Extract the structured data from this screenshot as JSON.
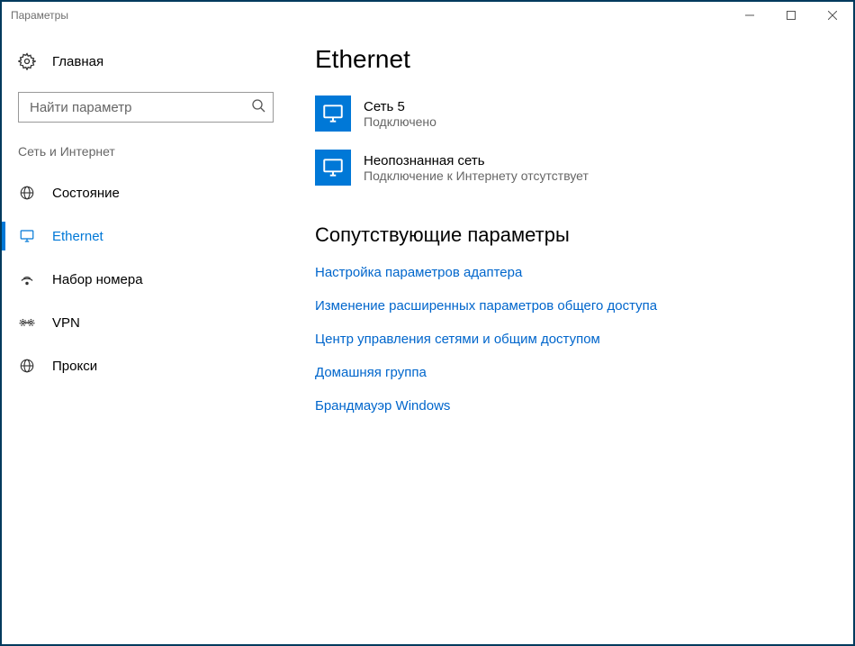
{
  "window": {
    "title": "Параметры"
  },
  "sidebar": {
    "home": "Главная",
    "search_placeholder": "Найти параметр",
    "category": "Сеть и Интернет",
    "items": [
      {
        "label": "Состояние"
      },
      {
        "label": "Ethernet"
      },
      {
        "label": "Набор номера"
      },
      {
        "label": "VPN"
      },
      {
        "label": "Прокси"
      }
    ]
  },
  "main": {
    "title": "Ethernet",
    "networks": [
      {
        "name": "Сеть  5",
        "status": "Подключено"
      },
      {
        "name": "Неопознанная сеть",
        "status": "Подключение к Интернету отсутствует"
      }
    ],
    "related_title": "Сопутствующие параметры",
    "related_links": [
      "Настройка параметров адаптера",
      "Изменение расширенных параметров общего доступа",
      "Центр управления сетями и общим доступом",
      "Домашняя группа",
      "Брандмауэр Windows"
    ]
  }
}
